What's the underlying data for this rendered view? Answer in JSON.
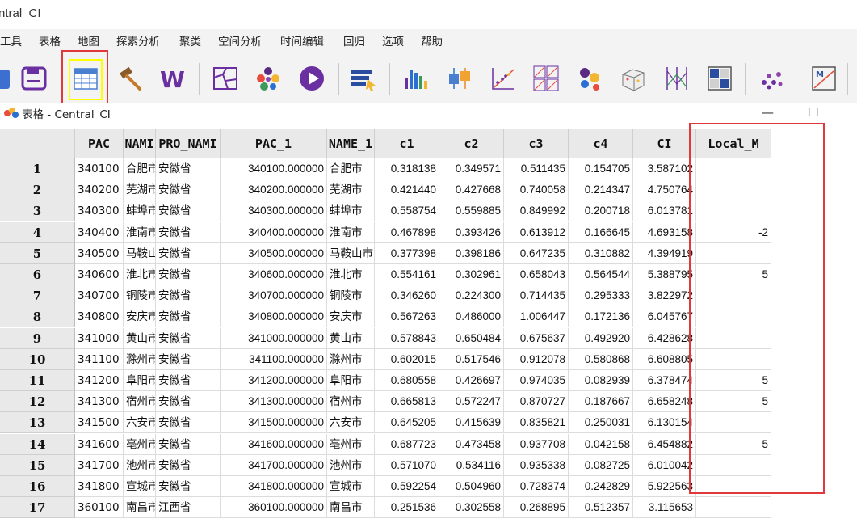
{
  "window": {
    "title": "Central_CI",
    "title_visible": "ntral_CI"
  },
  "menu": [
    "工具",
    "表格",
    "地图",
    "探索分析",
    "聚类",
    "空间分析",
    "时间编辑",
    "回归",
    "选项",
    "帮助"
  ],
  "menu_partial_first": "工具",
  "toolbar": {
    "icons": [
      "open-icon",
      "save-icon",
      "table-icon",
      "hammer-icon",
      "weights-icon",
      "map-icon",
      "cluster-map-icon",
      "play-icon",
      "category-editor-icon",
      "histogram-icon",
      "boxplot-icon",
      "scatter-icon",
      "scatter-matrix-icon",
      "bubble-chart-icon",
      "3d-scatter-icon",
      "parallel-coord-icon",
      "conditional-plot-icon",
      "cluster-dots-icon",
      "moran-icon"
    ]
  },
  "subwindow": {
    "title": "表格 - Central_CI",
    "minimize": "—",
    "maximize": "☐"
  },
  "table": {
    "columns": [
      "PAC",
      "NAME",
      "PRO_NAME",
      "PAC_1",
      "NAME_1",
      "c1",
      "c2",
      "c3",
      "c4",
      "CI",
      "Local_M"
    ],
    "columns_display": [
      "PAC",
      "NAMI",
      "PRO_NAMI",
      "PAC_1",
      "NAME_1",
      "c1",
      "c2",
      "c3",
      "c4",
      "CI",
      "Local_M"
    ],
    "rows": [
      {
        "n": "1",
        "pac": "340100",
        "name": "合肥市",
        "pro": "安徽省",
        "pac1": "340100.000000",
        "name1": "合肥市",
        "c1": "0.318138",
        "c2": "0.349571",
        "c3": "0.511435",
        "c4": "0.154705",
        "ci": "3.587102",
        "lm": ""
      },
      {
        "n": "2",
        "pac": "340200",
        "name": "芜湖市",
        "pro": "安徽省",
        "pac1": "340200.000000",
        "name1": "芜湖市",
        "c1": "0.421440",
        "c2": "0.427668",
        "c3": "0.740058",
        "c4": "0.214347",
        "ci": "4.750764",
        "lm": ""
      },
      {
        "n": "3",
        "pac": "340300",
        "name": "蚌埠市",
        "pro": "安徽省",
        "pac1": "340300.000000",
        "name1": "蚌埠市",
        "c1": "0.558754",
        "c2": "0.559885",
        "c3": "0.849992",
        "c4": "0.200718",
        "ci": "6.013781",
        "lm": ""
      },
      {
        "n": "4",
        "pac": "340400",
        "name": "淮南市",
        "pro": "安徽省",
        "pac1": "340400.000000",
        "name1": "淮南市",
        "c1": "0.467898",
        "c2": "0.393426",
        "c3": "0.613912",
        "c4": "0.166645",
        "ci": "4.693158",
        "lm": "-2"
      },
      {
        "n": "5",
        "pac": "340500",
        "name": "马鞍山市",
        "pro": "安徽省",
        "pac1": "340500.000000",
        "name1": "马鞍山市",
        "c1": "0.377398",
        "c2": "0.398186",
        "c3": "0.647235",
        "c4": "0.310882",
        "ci": "4.394919",
        "lm": ""
      },
      {
        "n": "6",
        "pac": "340600",
        "name": "淮北市",
        "pro": "安徽省",
        "pac1": "340600.000000",
        "name1": "淮北市",
        "c1": "0.554161",
        "c2": "0.302961",
        "c3": "0.658043",
        "c4": "0.564544",
        "ci": "5.388795",
        "lm": "5"
      },
      {
        "n": "7",
        "pac": "340700",
        "name": "铜陵市",
        "pro": "安徽省",
        "pac1": "340700.000000",
        "name1": "铜陵市",
        "c1": "0.346260",
        "c2": "0.224300",
        "c3": "0.714435",
        "c4": "0.295333",
        "ci": "3.822972",
        "lm": ""
      },
      {
        "n": "8",
        "pac": "340800",
        "name": "安庆市",
        "pro": "安徽省",
        "pac1": "340800.000000",
        "name1": "安庆市",
        "c1": "0.567263",
        "c2": "0.486000",
        "c3": "1.006447",
        "c4": "0.172136",
        "ci": "6.045767",
        "lm": ""
      },
      {
        "n": "9",
        "pac": "341000",
        "name": "黄山市",
        "pro": "安徽省",
        "pac1": "341000.000000",
        "name1": "黄山市",
        "c1": "0.578843",
        "c2": "0.650484",
        "c3": "0.675637",
        "c4": "0.492920",
        "ci": "6.428628",
        "lm": ""
      },
      {
        "n": "10",
        "pac": "341100",
        "name": "滁州市",
        "pro": "安徽省",
        "pac1": "341100.000000",
        "name1": "滁州市",
        "c1": "0.602015",
        "c2": "0.517546",
        "c3": "0.912078",
        "c4": "0.580868",
        "ci": "6.608805",
        "lm": ""
      },
      {
        "n": "11",
        "pac": "341200",
        "name": "阜阳市",
        "pro": "安徽省",
        "pac1": "341200.000000",
        "name1": "阜阳市",
        "c1": "0.680558",
        "c2": "0.426697",
        "c3": "0.974035",
        "c4": "0.082939",
        "ci": "6.378474",
        "lm": "5"
      },
      {
        "n": "12",
        "pac": "341300",
        "name": "宿州市",
        "pro": "安徽省",
        "pac1": "341300.000000",
        "name1": "宿州市",
        "c1": "0.665813",
        "c2": "0.572247",
        "c3": "0.870727",
        "c4": "0.187667",
        "ci": "6.658248",
        "lm": "5"
      },
      {
        "n": "13",
        "pac": "341500",
        "name": "六安市",
        "pro": "安徽省",
        "pac1": "341500.000000",
        "name1": "六安市",
        "c1": "0.645205",
        "c2": "0.415639",
        "c3": "0.835821",
        "c4": "0.250031",
        "ci": "6.130154",
        "lm": ""
      },
      {
        "n": "14",
        "pac": "341600",
        "name": "亳州市",
        "pro": "安徽省",
        "pac1": "341600.000000",
        "name1": "亳州市",
        "c1": "0.687723",
        "c2": "0.473458",
        "c3": "0.937708",
        "c4": "0.042158",
        "ci": "6.454882",
        "lm": "5"
      },
      {
        "n": "15",
        "pac": "341700",
        "name": "池州市",
        "pro": "安徽省",
        "pac1": "341700.000000",
        "name1": "池州市",
        "c1": "0.571070",
        "c2": "0.534116",
        "c3": "0.935338",
        "c4": "0.082725",
        "ci": "6.010042",
        "lm": ""
      },
      {
        "n": "16",
        "pac": "341800",
        "name": "宣城市",
        "pro": "安徽省",
        "pac1": "341800.000000",
        "name1": "宣城市",
        "c1": "0.592254",
        "c2": "0.504960",
        "c3": "0.728374",
        "c4": "0.242829",
        "ci": "5.922563",
        "lm": ""
      },
      {
        "n": "17",
        "pac": "360100",
        "name": "南昌市",
        "pro": "江西省",
        "pac1": "360100.000000",
        "name1": "南昌市",
        "c1": "0.251536",
        "c2": "0.302558",
        "c3": "0.268895",
        "c4": "0.512357",
        "ci": "3.115653",
        "lm": ""
      }
    ]
  },
  "colors": {
    "annotation_red": "#e0383b",
    "annotation_yellow": "#ffff00",
    "header_bg": "#e9e9e9"
  }
}
